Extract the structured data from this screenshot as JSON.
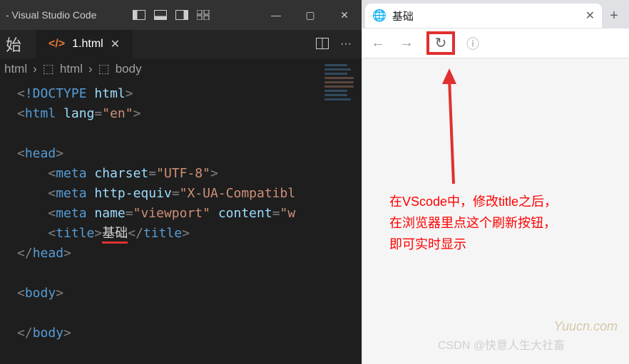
{
  "vscode": {
    "title": "- Visual Studio Code",
    "sidebit": "始",
    "tab": {
      "name": "1.html",
      "close": "✕"
    },
    "breadcrumbs": [
      "html",
      "html",
      "body"
    ],
    "code": {
      "l1_doctype_tag": "!DOCTYPE",
      "l1_doctype_val": "html",
      "l2_tag": "html",
      "l2_attr": "lang",
      "l2_val": "\"en\"",
      "l4_tag": "head",
      "l5_tag": "meta",
      "l5_attr": "charset",
      "l5_val": "\"UTF-8\"",
      "l6_tag": "meta",
      "l6_attr": "http-equiv",
      "l6_val": "\"X-UA-Compatibl",
      "l7_tag": "meta",
      "l7_attr1": "name",
      "l7_val1": "\"viewport\"",
      "l7_attr2": "content",
      "l7_val2": "\"w",
      "l8_tag": "title",
      "l8_text": "基础",
      "l8_close": "title",
      "l9_tag": "head",
      "l11_tag": "body",
      "l13_tag": "body"
    }
  },
  "browser": {
    "tab_title": "基础",
    "back": "←",
    "forward": "→",
    "reload": "↻",
    "info": "ⓘ",
    "newtab": "+",
    "close": "✕"
  },
  "annotation": {
    "line1": "在VScode中，修改title之后，",
    "line2": "在浏览器里点这个刷新按钮，",
    "line3": "即可实时显示"
  },
  "watermark1": "Yuucn.com",
  "watermark2": "CSDN @快意人生大社畜"
}
